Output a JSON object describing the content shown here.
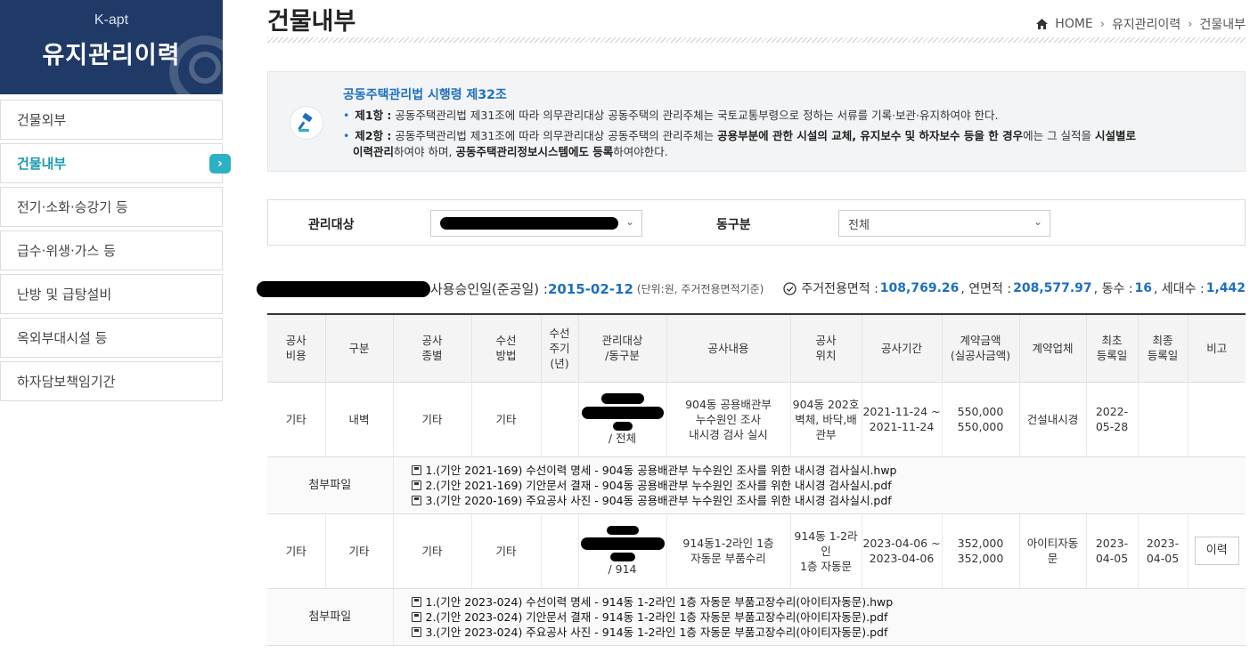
{
  "sidebar": {
    "brand": "K-apt",
    "title": "유지관리이력",
    "items": [
      {
        "label": "건물외부",
        "active": false
      },
      {
        "label": "건물내부",
        "active": true
      },
      {
        "label": "전기·소화·승강기 등",
        "active": false
      },
      {
        "label": "급수·위생·가스 등",
        "active": false
      },
      {
        "label": "난방 및 급탕설비",
        "active": false
      },
      {
        "label": "옥외부대시설 등",
        "active": false
      },
      {
        "label": "하자담보책임기간",
        "active": false
      }
    ],
    "arrow": "›"
  },
  "header": {
    "title": "건물내부",
    "breadcrumb": [
      "HOME",
      "유지관리이력",
      "건물내부"
    ]
  },
  "law": {
    "title": "공동주택관리법 시행령 제32조",
    "clause1_label": "제1항 :",
    "clause1_text": " 공동주택관리법 제31조에 따라 의무관리대상 공동주택의 관리주체는 국토교통부령으로 정하는 서류를 기록·보관·유지하여야 한다.",
    "clause2_label": "제2항 :",
    "clause2_a": " 공동주택관리법 제31조에 따라 의무관리대상 공동주택의 관리주체는 ",
    "clause2_b": "공용부분에 관한 시설의 교체, 유지보수 및 하자보수 등을 한 경우",
    "clause2_c": "에는 그 실적을 ",
    "clause2_d": "시설별로",
    "clause2_e": "이력관리",
    "clause2_f": "하여야 하며, ",
    "clause2_g": "공동주택관리정보시스템에도 등록",
    "clause2_h": "하여야한다."
  },
  "filter": {
    "target_label": "관리대상",
    "dong_label": "동구분",
    "dong_value": "전체"
  },
  "summary": {
    "approval_label": "사용승인일(준공일) : ",
    "approval_date": "2015-02-12",
    "unit_note": "(단위:원, 주거전용면적기준)",
    "area_label": "주거전용면적 : ",
    "area_value": "108,769.26",
    "total_label": ", 연면적 : ",
    "total_value": "208,577.97",
    "dong_label": ", 동수 : ",
    "dong_value": "16",
    "house_label": ", 세대수 : ",
    "house_value": "1,442"
  },
  "table": {
    "headers": [
      "공사\n비용",
      "구분",
      "공사\n종별",
      "수선\n방법",
      "수선\n주기\n(년)",
      "관리대상\n/동구분",
      "공사내용",
      "공사\n위치",
      "공사기간",
      "계약금액\n(실공사금액)",
      "계약업체",
      "최초\n등록일",
      "최종\n등록일",
      "비고"
    ],
    "rows": [
      {
        "cost": "기타",
        "category": "내벽",
        "type": "기타",
        "method": "기타",
        "cycle": "",
        "dong": "/ 전체",
        "content": "904동 공용배관부\n누수원인 조사\n내시경 검사 실시",
        "location": "904동 202호\n벽체, 바닥,배관부",
        "period": "2021-11-24 ~\n2021-11-24",
        "amount": "550,000\n550,000",
        "company": "건설내시경",
        "first": "2022-\n05-28",
        "last": "",
        "note": "",
        "files_label": "첨부파일",
        "files": [
          "1.(기안 2021-169) 수선이력 명세 - 904동 공용배관부 누수원인 조사를 위한 내시경 검사실시.hwp",
          "2.(기안 2021-169) 기안문서 결재 - 904동 공용배관부 누수원인 조사를 위한 내시경 검사실시.pdf",
          "3.(기안 2020-169) 주요공사 사진 - 904동 공용배관부 누수원인 조사를 위한 내시경 검사실시.pdf"
        ]
      },
      {
        "cost": "기타",
        "category": "기타",
        "type": "기타",
        "method": "기타",
        "cycle": "",
        "dong": "/ 914",
        "content": "914동1-2라인 1층\n자동문 부품수리",
        "location": "914동 1-2라인\n1층 자동문",
        "period": "2023-04-06 ~\n2023-04-06",
        "amount": "352,000\n352,000",
        "company": "아이티자동\n문",
        "first": "2023-\n04-05",
        "last": "2023-\n04-05",
        "note": "이력",
        "files_label": "첨부파일",
        "files": [
          "1.(기안 2023-024) 수선이력 명세 - 914동 1-2라인 1층 자동문 부품고장수리(아이티자동문).hwp",
          "2.(기안 2023-024) 기안문서 결재 - 914동 1-2라인 1층 자동문 부품고장수리(아이티자동문).pdf",
          "3.(기안 2023-024) 주요공사 사진 - 914동 1-2라인 1층 자동문 부품고장수리(아이티자동문).pdf"
        ]
      }
    ]
  },
  "colors": {
    "accent": "#1e6fbf",
    "sidebar_bg": "#1f3a66",
    "active": "#1a9ab3"
  }
}
